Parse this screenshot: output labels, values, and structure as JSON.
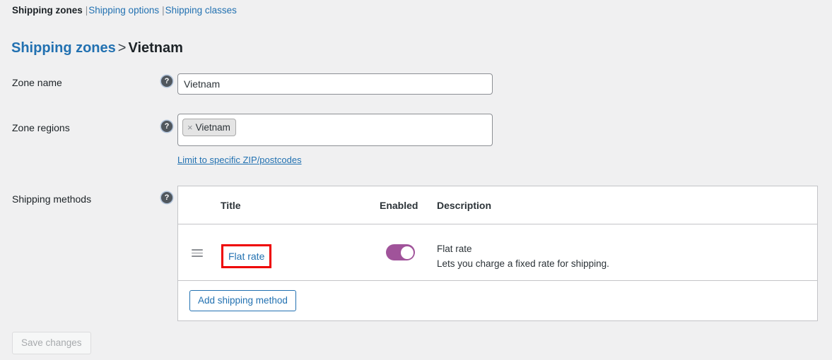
{
  "subnav": {
    "items": [
      {
        "label": "Shipping zones",
        "active": true
      },
      {
        "label": "Shipping options",
        "active": false
      },
      {
        "label": "Shipping classes",
        "active": false
      }
    ],
    "separator": "|"
  },
  "heading": {
    "parent_label": "Shipping zones",
    "separator": ">",
    "current_label": "Vietnam"
  },
  "form": {
    "zone_name": {
      "label": "Zone name",
      "help_icon": "question-mark-icon",
      "value": "Vietnam",
      "placeholder": "Zone name"
    },
    "zone_regions": {
      "label": "Zone regions",
      "help_icon": "question-mark-icon",
      "tokens": [
        {
          "remove_glyph": "×",
          "label": "Vietnam"
        }
      ],
      "postcode_link": "Limit to specific ZIP/postcodes"
    },
    "shipping_methods": {
      "label": "Shipping methods",
      "help_icon": "question-mark-icon"
    }
  },
  "methods_table": {
    "columns": {
      "title": "Title",
      "enabled": "Enabled",
      "description": "Description"
    },
    "rows": [
      {
        "drag_icon": "drag-handle-icon",
        "title": "Flat rate",
        "enabled": true,
        "description_title": "Flat rate",
        "description_text": "Lets you charge a fixed rate for shipping."
      }
    ],
    "add_button": "Add shipping method"
  },
  "footer": {
    "save_button": "Save changes",
    "save_disabled": true
  },
  "colors": {
    "page_background": "#f0f0f1",
    "link_blue": "#2271b1",
    "toggle_on": "#a0539a",
    "highlight_red": "#ee0000",
    "border_grey": "#c3c4c7",
    "text_dark": "#1d2327"
  }
}
